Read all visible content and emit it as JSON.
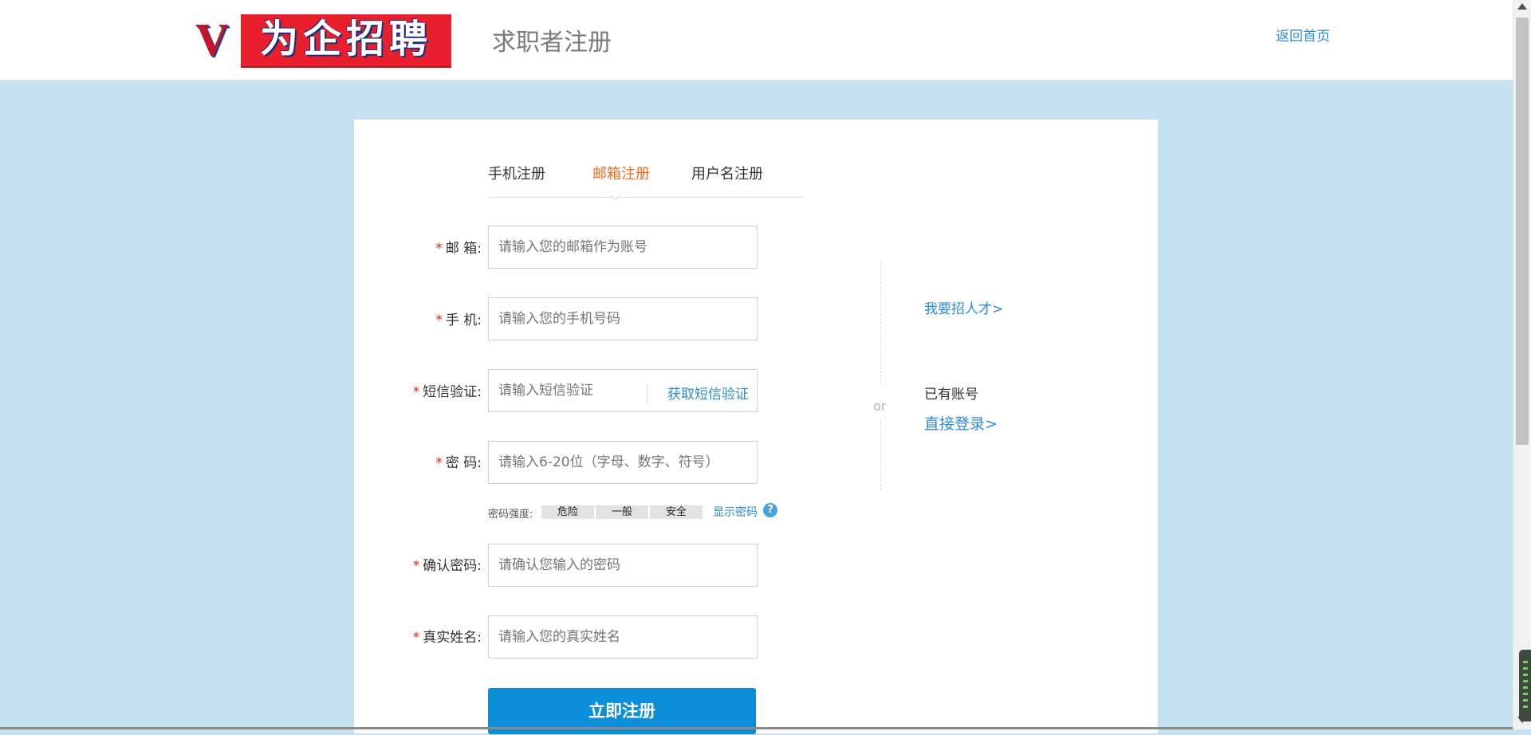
{
  "header": {
    "logo_letter": "V",
    "logo_text": "为企招聘",
    "page_title": "求职者注册",
    "back_home": "返回首页"
  },
  "tabs": [
    {
      "label": "手机注册",
      "active": false
    },
    {
      "label": "邮箱注册",
      "active": true
    },
    {
      "label": "用户名注册",
      "active": false
    }
  ],
  "form": {
    "email": {
      "label": "邮 箱:",
      "placeholder": "请输入您的邮箱作为账号"
    },
    "phone": {
      "label": "手 机:",
      "placeholder": "请输入您的手机号码"
    },
    "sms": {
      "label": "短信验证:",
      "placeholder": "请输入短信验证",
      "button": "获取短信验证"
    },
    "password": {
      "label": "密 码:",
      "placeholder": "请输入6-20位（字母、数字、符号）"
    },
    "strength": {
      "label": "密码强度:",
      "levels": [
        "危险",
        "一般",
        "安全"
      ],
      "show_password": "显示密码",
      "help": "?"
    },
    "confirm": {
      "label": "确认密码:",
      "placeholder": "请确认您输入的密码"
    },
    "realname": {
      "label": "真实姓名:",
      "placeholder": "请输入您的真实姓名"
    },
    "required_mark": "*",
    "submit": "立即注册"
  },
  "side": {
    "recruit_link": "我要招人才>",
    "or": "or",
    "has_account": "已有账号",
    "login_link": "直接登录>"
  },
  "colors": {
    "accent": "#0d8ed9",
    "link": "#2d8bd5",
    "active_tab": "#f26b1d",
    "background": "#c6e1f0",
    "required": "#e1251b"
  }
}
